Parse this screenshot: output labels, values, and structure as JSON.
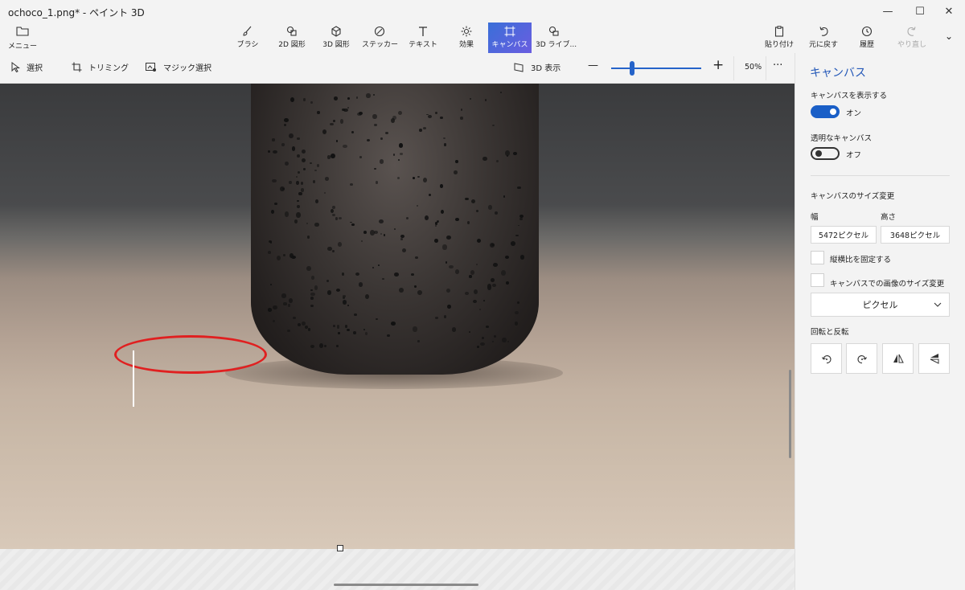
{
  "window": {
    "title": "ochoco_1.png* - ペイント 3D",
    "minimize": "—",
    "maximize": "☐",
    "close": "✕"
  },
  "ribbon": {
    "menu_label": "メニュー",
    "tools": [
      {
        "label": "ブラシ",
        "icon": "brush-icon"
      },
      {
        "label": "2D 図形",
        "icon": "2d-shapes-icon"
      },
      {
        "label": "3D 図形",
        "icon": "3d-shapes-icon"
      },
      {
        "label": "ステッカー",
        "icon": "sticker-icon"
      },
      {
        "label": "テキスト",
        "icon": "text-icon"
      },
      {
        "label": "効果",
        "icon": "effects-icon"
      },
      {
        "label": "キャンバス",
        "icon": "canvas-icon"
      },
      {
        "label": "3D ライブ...",
        "icon": "3d-library-icon"
      }
    ],
    "right_tools": [
      {
        "label": "貼り付け",
        "icon": "paste-icon"
      },
      {
        "label": "元に戻す",
        "icon": "undo-icon"
      },
      {
        "label": "履歴",
        "icon": "history-icon"
      },
      {
        "label": "やり直し",
        "icon": "redo-icon"
      }
    ],
    "more": "⌄"
  },
  "subbar": {
    "select": "選択",
    "crop": "トリミング",
    "magic_select": "マジック選択",
    "view_3d": "3D 表示",
    "zoom_minus": "—",
    "zoom_plus": "+",
    "zoom_level": "50%",
    "more": "···"
  },
  "panel": {
    "title": "キャンバス",
    "show_canvas_label": "キャンバスを表示する",
    "show_canvas_state": "オン",
    "transparent_label": "透明なキャンバス",
    "transparent_state": "オフ",
    "resize_label": "キャンバスのサイズ変更",
    "width_label": "幅",
    "height_label": "高さ",
    "width_value": "5472ピクセル",
    "height_value": "3648ピクセル",
    "lock_aspect": "縦横比を固定する",
    "resize_image": "キャンバスでの画像のサイズ変更",
    "unit": "ピクセル",
    "rotate_flip_label": "回転と反転"
  }
}
